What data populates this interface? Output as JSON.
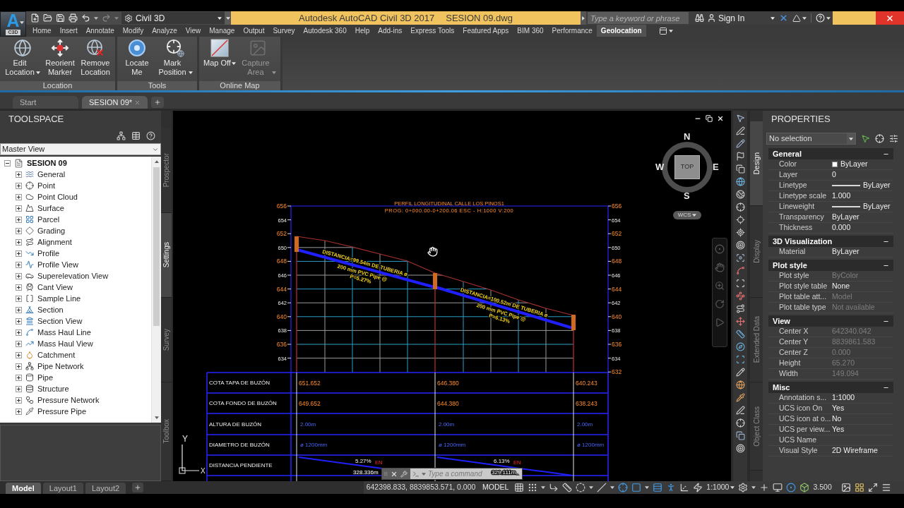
{
  "app_button": {
    "logo_letter": "A",
    "label": "C3D"
  },
  "workspace": {
    "value": "Civil 3D"
  },
  "title_bar": {
    "app_title": "Autodesk AutoCAD Civil 3D 2017",
    "file_name": "SESION 09.dwg"
  },
  "search": {
    "placeholder": "Type a keyword or phrase"
  },
  "sign_in": {
    "label": "Sign In"
  },
  "ribbon_tabs": [
    {
      "label": "Home",
      "selected": false
    },
    {
      "label": "Insert",
      "selected": false
    },
    {
      "label": "Annotate",
      "selected": false
    },
    {
      "label": "Modify",
      "selected": false
    },
    {
      "label": "Analyze",
      "selected": false
    },
    {
      "label": "View",
      "selected": false
    },
    {
      "label": "Manage",
      "selected": false
    },
    {
      "label": "Output",
      "selected": false
    },
    {
      "label": "Survey",
      "selected": false
    },
    {
      "label": "Autodesk 360",
      "selected": false
    },
    {
      "label": "Help",
      "selected": false
    },
    {
      "label": "Add-ins",
      "selected": false
    },
    {
      "label": "Express Tools",
      "selected": false
    },
    {
      "label": "Featured Apps",
      "selected": false
    },
    {
      "label": "BIM 360",
      "selected": false
    },
    {
      "label": "Performance",
      "selected": false
    },
    {
      "label": "Geolocation",
      "selected": true
    }
  ],
  "ribbon_panels": [
    {
      "title": "Location",
      "buttons": [
        {
          "label": "Edit Location",
          "dropdown": true,
          "disabled": false
        },
        {
          "label": "Reorient Marker",
          "dropdown": false,
          "disabled": false
        },
        {
          "label": "Remove Location",
          "dropdown": false,
          "disabled": false
        }
      ]
    },
    {
      "title": "Tools",
      "buttons": [
        {
          "label": "Locate Me",
          "dropdown": false,
          "disabled": false
        },
        {
          "label": "Mark Position",
          "dropdown": true,
          "disabled": false
        }
      ]
    },
    {
      "title": "Online Map",
      "buttons": [
        {
          "label": "Map Off",
          "dropdown": true,
          "disabled": false
        },
        {
          "label": "Capture Area",
          "dropdown": true,
          "disabled": true
        }
      ]
    }
  ],
  "file_tabs": [
    {
      "label": "Start",
      "selected": false,
      "closable": false
    },
    {
      "label": "SESION 09*",
      "selected": true,
      "closable": true
    }
  ],
  "toolspace": {
    "title": "TOOLSPACE",
    "view": "Master View",
    "tree": {
      "label": "SESION 09",
      "expanded": true,
      "children": [
        {
          "label": "General",
          "expanded": false
        },
        {
          "label": "Point",
          "expanded": false
        },
        {
          "label": "Point Cloud",
          "expanded": false
        },
        {
          "label": "Surface",
          "expanded": false
        },
        {
          "label": "Parcel",
          "expanded": false
        },
        {
          "label": "Grading",
          "expanded": false
        },
        {
          "label": "Alignment",
          "expanded": false
        },
        {
          "label": "Profile",
          "expanded": false
        },
        {
          "label": "Profile View",
          "expanded": false
        },
        {
          "label": "Superelevation View",
          "expanded": false
        },
        {
          "label": "Cant View",
          "expanded": false
        },
        {
          "label": "Sample Line",
          "expanded": false
        },
        {
          "label": "Section",
          "expanded": false
        },
        {
          "label": "Section View",
          "expanded": false
        },
        {
          "label": "Mass Haul Line",
          "expanded": false
        },
        {
          "label": "Mass Haul View",
          "expanded": false
        },
        {
          "label": "Catchment",
          "expanded": false
        },
        {
          "label": "Pipe Network",
          "expanded": false
        },
        {
          "label": "Pipe",
          "expanded": false
        },
        {
          "label": "Structure",
          "expanded": false
        },
        {
          "label": "Pressure Network",
          "expanded": false
        },
        {
          "label": "Pressure Pipe",
          "expanded": false
        }
      ]
    },
    "tabs": [
      {
        "label": "Prospector",
        "selected": false
      },
      {
        "label": "Settings",
        "selected": true
      },
      {
        "label": "Survey",
        "selected": false
      },
      {
        "label": "Toolbox",
        "selected": false
      }
    ]
  },
  "drawing": {
    "view_cube": {
      "north": "N",
      "west": "W",
      "east": "E",
      "south": "S",
      "face": "TOP",
      "coordinate_system": "WCS"
    },
    "profile": {
      "title": "PERFIL LONGITUDINAL CALLE LOS PINOS1",
      "subtitle": "PROG: 0+000.00-0+200.06 ESC - H:1000 V:200",
      "left_axis": [
        {
          "label": "656",
          "major": true
        },
        {
          "label": "654",
          "major": false
        },
        {
          "label": "652",
          "major": true
        },
        {
          "label": "650",
          "major": false
        },
        {
          "label": "648",
          "major": true
        },
        {
          "label": "646",
          "major": false
        },
        {
          "label": "644",
          "major": true
        },
        {
          "label": "642",
          "major": false
        },
        {
          "label": "640",
          "major": true
        },
        {
          "label": "638",
          "major": false
        },
        {
          "label": "636",
          "major": true
        },
        {
          "label": "634",
          "major": false
        }
      ],
      "right_axis": [
        {
          "label": "656",
          "major": true
        },
        {
          "label": "654",
          "major": false
        },
        {
          "label": "652",
          "major": true
        },
        {
          "label": "650",
          "major": false
        },
        {
          "label": "648",
          "major": true
        },
        {
          "label": "646",
          "major": false
        },
        {
          "label": "644",
          "major": true
        },
        {
          "label": "642",
          "major": false
        },
        {
          "label": "640",
          "major": true
        },
        {
          "label": "638",
          "major": false
        },
        {
          "label": "636",
          "major": true
        },
        {
          "label": "634",
          "major": false
        },
        {
          "label": "632",
          "major": true
        }
      ],
      "pipe_labels": [
        {
          "lines": [
            "DISTANCIA=99.54m DE TUBERIA ø",
            "200 mm PVC Pipe @",
            "P=5.27%"
          ]
        },
        {
          "lines": [
            "DISTANCIA=100.52m DE TUBERIA ø",
            "200 mm PVC Pipe @",
            "P=6.13%"
          ]
        }
      ],
      "table": {
        "rows": [
          {
            "kind": "elevation",
            "label": "COTA TAPA DE BUZÓN",
            "cells": [
              "651.652",
              "646.380",
              "640.243"
            ]
          },
          {
            "kind": "elevation",
            "label": "COTA FONDO DE BUZÓN",
            "cells": [
              "649.652",
              "644.380",
              "638.243"
            ]
          },
          {
            "kind": "tag",
            "label": "ALTURA DE BUZÓN",
            "cells": [
              "2.00m",
              "2.00m",
              "2.00m"
            ]
          },
          {
            "kind": "tag",
            "label": "DIAMETRO DE BUZÓN",
            "cells": [
              "ø 1200mm",
              "ø 1200mm",
              "ø 1200mm"
            ]
          },
          {
            "kind": "segments",
            "label": "DISTANCIA PENDIENTE",
            "segments": [
              {
                "slope": "5.27%",
                "code": "EN",
                "length": "328.336m"
              },
              {
                "slope": "6.13%",
                "code": "EN",
                "length": "329.111m"
              }
            ]
          }
        ]
      }
    },
    "ucs_icon": {
      "y_label": "Y",
      "x_label": "X"
    },
    "command_line": {
      "placeholder": "Type a command"
    }
  },
  "properties": {
    "title": "PROPERTIES",
    "selection": "No selection",
    "tabs": [
      {
        "label": "Design",
        "selected": true
      },
      {
        "label": "Display",
        "selected": false
      },
      {
        "label": "Extended Data",
        "selected": false
      },
      {
        "label": "Object Class",
        "selected": false
      }
    ],
    "sections": [
      {
        "title": "General",
        "expanded": true,
        "rows": [
          {
            "label": "Color",
            "value": "ByLayer",
            "kind": "swatch",
            "disabled": false
          },
          {
            "label": "Layer",
            "value": "0",
            "kind": "text",
            "disabled": false
          },
          {
            "label": "Linetype",
            "value": "ByLayer",
            "kind": "line",
            "disabled": false
          },
          {
            "label": "Linetype scale",
            "value": "1.000",
            "kind": "text",
            "disabled": false
          },
          {
            "label": "Lineweight",
            "value": "ByLayer",
            "kind": "line",
            "disabled": false
          },
          {
            "label": "Transparency",
            "value": "ByLayer",
            "kind": "text",
            "disabled": false
          },
          {
            "label": "Thickness",
            "value": "0.000",
            "kind": "text",
            "disabled": false
          }
        ]
      },
      {
        "title": "3D Visualization",
        "expanded": true,
        "rows": [
          {
            "label": "Material",
            "value": "ByLayer",
            "kind": "text",
            "disabled": false
          }
        ]
      },
      {
        "title": "Plot style",
        "expanded": true,
        "rows": [
          {
            "label": "Plot style",
            "value": "ByColor",
            "kind": "text",
            "disabled": true
          },
          {
            "label": "Plot style table",
            "value": "None",
            "kind": "text",
            "disabled": false
          },
          {
            "label": "Plot table att...",
            "value": "Model",
            "kind": "text",
            "disabled": true
          },
          {
            "label": "Plot table type",
            "value": "Not available",
            "kind": "text",
            "disabled": true
          }
        ]
      },
      {
        "title": "View",
        "expanded": true,
        "rows": [
          {
            "label": "Center X",
            "value": "642340.042",
            "kind": "text",
            "disabled": true
          },
          {
            "label": "Center Y",
            "value": "8839861.583",
            "kind": "text",
            "disabled": true
          },
          {
            "label": "Center Z",
            "value": "0.000",
            "kind": "text",
            "disabled": true
          },
          {
            "label": "Height",
            "value": "65.270",
            "kind": "text",
            "disabled": true
          },
          {
            "label": "Width",
            "value": "149.094",
            "kind": "text",
            "disabled": true
          }
        ]
      },
      {
        "title": "Misc",
        "expanded": true,
        "rows": [
          {
            "label": "Annotation s...",
            "value": "1:1000",
            "kind": "text",
            "disabled": false
          },
          {
            "label": "UCS icon On",
            "value": "Yes",
            "kind": "text",
            "disabled": false
          },
          {
            "label": "UCS icon at o...",
            "value": "No",
            "kind": "text",
            "disabled": false
          },
          {
            "label": "UCS per view...",
            "value": "Yes",
            "kind": "text",
            "disabled": false
          },
          {
            "label": "UCS Name",
            "kind": "text"
          },
          {
            "label": "Visual Style",
            "value": "2D Wireframe",
            "kind": "text",
            "disabled": false
          }
        ]
      }
    ]
  },
  "layout_tabs": [
    {
      "label": "Model",
      "selected": true
    },
    {
      "label": "Layout1",
      "selected": false
    },
    {
      "label": "Layout2",
      "selected": false
    }
  ],
  "status_bar": {
    "coordinates": "642398.833, 8839853.571, 0.000",
    "space": "MODEL",
    "toggles": [
      {
        "on": false
      },
      {
        "on": false
      },
      {
        "on": false
      },
      {
        "on": false
      },
      {
        "on": false
      },
      {
        "on": false
      },
      {
        "on": true
      },
      {
        "on": true
      },
      {
        "on": true
      },
      {
        "on": true
      },
      {
        "on": false
      },
      {
        "on": false
      }
    ],
    "annotation_scale": "1:1000",
    "right_toggles": [
      {
        "on": false
      },
      {
        "on": false
      },
      {
        "on": false
      },
      {
        "on": true
      }
    ],
    "value": "3.500"
  }
}
